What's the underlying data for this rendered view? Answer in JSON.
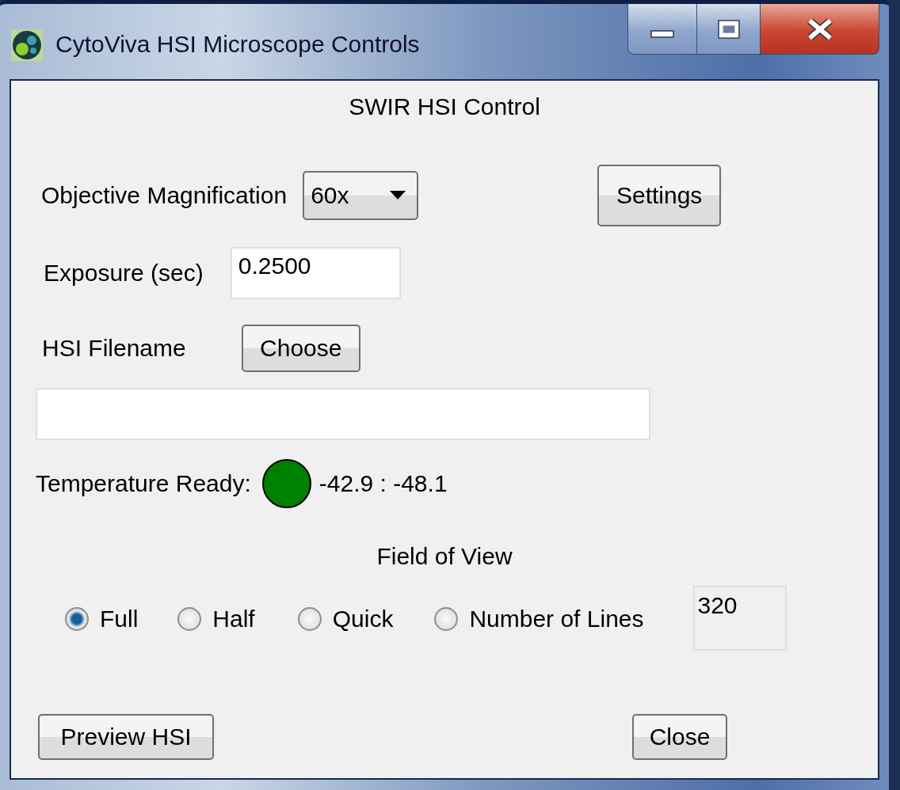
{
  "window": {
    "title": "CytoViva HSI Microscope Controls"
  },
  "heading": "SWIR HSI Control",
  "objective": {
    "label": "Objective Magnification",
    "value": "60x"
  },
  "settings_button": "Settings",
  "exposure": {
    "label": "Exposure (sec)",
    "value": "0.2500"
  },
  "filename": {
    "label": "HSI Filename",
    "button": "Choose"
  },
  "temperature": {
    "label": "Temperature Ready:",
    "ready": true,
    "reading": "-42.9 : -48.1"
  },
  "field_of_view": {
    "title": "Field of View",
    "options": [
      {
        "label": "Full",
        "selected": true
      },
      {
        "label": "Half",
        "selected": false
      },
      {
        "label": "Quick",
        "selected": false
      },
      {
        "label": "Number of Lines",
        "selected": false
      }
    ],
    "lines_value": "320"
  },
  "buttons": [
    "Preview HSI",
    "Close"
  ]
}
